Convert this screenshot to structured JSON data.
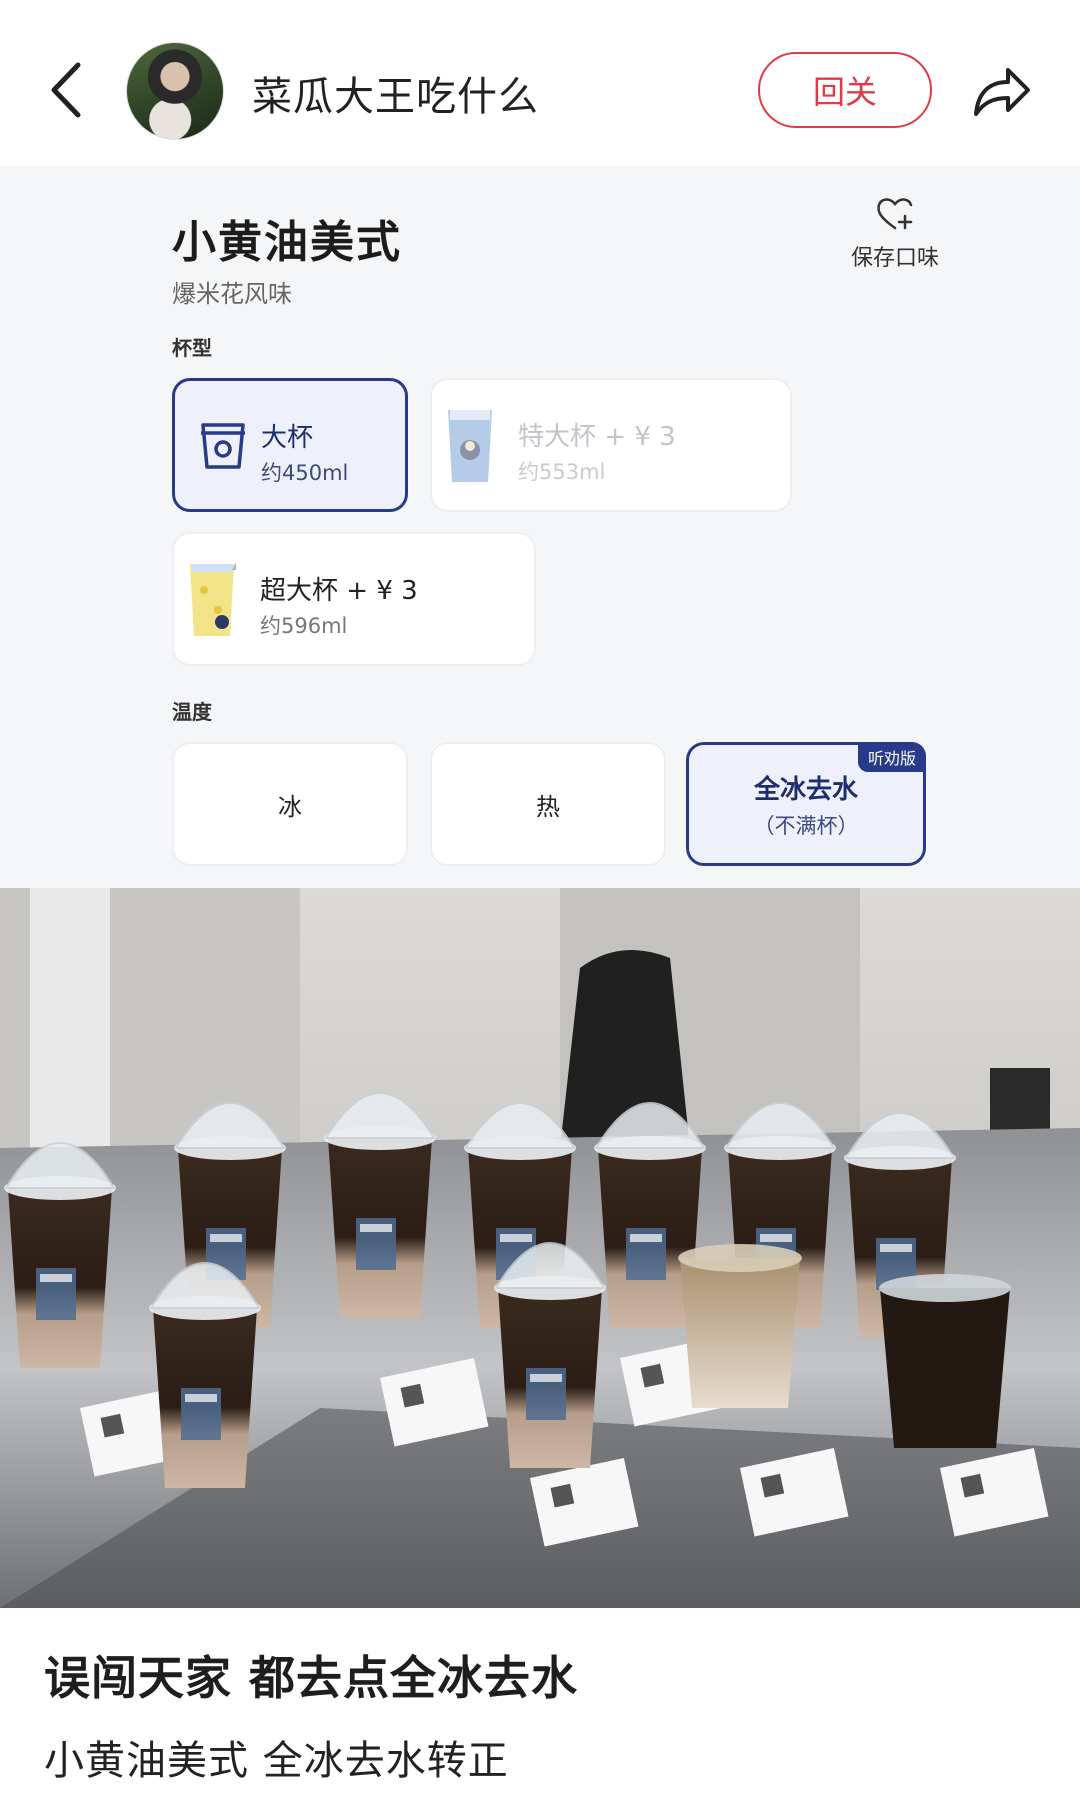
{
  "header": {
    "author_name": "菜瓜大王吃什么",
    "follow_label": "回关"
  },
  "drink": {
    "name": "小黄油美式",
    "flavor": "爆米花风味",
    "save_label": "保存口味"
  },
  "cup_section": {
    "label": "杯型",
    "options": [
      {
        "title": "大杯",
        "sub": "约450ml",
        "state": "selected"
      },
      {
        "title": "特大杯 + ¥ 3",
        "sub": "约553ml",
        "state": "disabled"
      },
      {
        "title": "超大杯 + ¥ 3",
        "sub": "约596ml",
        "state": "available"
      }
    ]
  },
  "temp_section": {
    "label": "温度",
    "options": [
      {
        "label": "冰",
        "state": "available"
      },
      {
        "label": "热",
        "state": "available"
      },
      {
        "label": "全冰去水",
        "sub": "（不满杯）",
        "badge": "听劝版",
        "state": "selected"
      }
    ]
  },
  "post": {
    "title": "误闯天家 都去点全冰去水",
    "body": "小黄油美式 全冰去水转正"
  },
  "colors": {
    "accent_red": "#e03a48",
    "selected_border": "#283b8a",
    "selected_bg": "#eef1fb"
  }
}
